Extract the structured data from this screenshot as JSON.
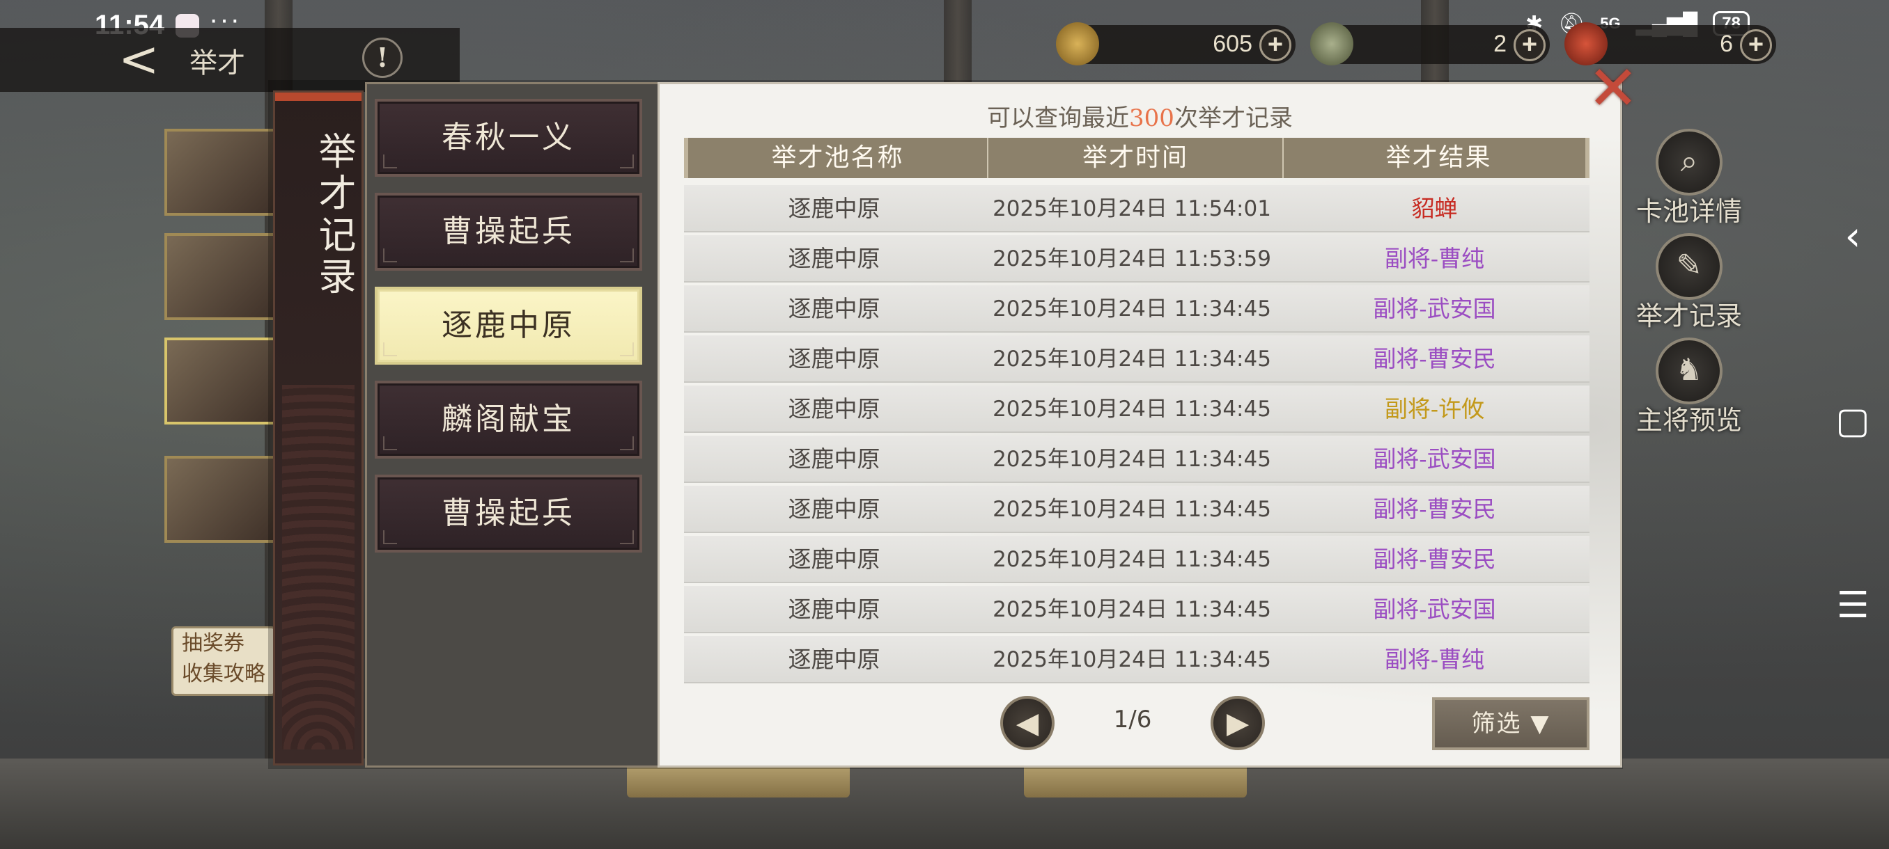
{
  "status_bar": {
    "time": "11:54",
    "more": "···",
    "battery": "78",
    "network": "5G"
  },
  "header": {
    "back_icon": "back-arrow-icon",
    "title": "举才",
    "help_label": "!"
  },
  "resources": [
    {
      "value": "605",
      "icon": "coin-icon"
    },
    {
      "value": "2",
      "icon": "jade-icon"
    },
    {
      "value": "6",
      "icon": "token-icon"
    }
  ],
  "side_menu": [
    {
      "label": "卡池详情",
      "icon": "magnifier-icon"
    },
    {
      "label": "举才记录",
      "icon": "scroll-icon"
    },
    {
      "label": "主将预览",
      "icon": "general-icon"
    }
  ],
  "background": {
    "ticket_line1": "抽奖券",
    "ticket_line2": "收集攻略"
  },
  "dialog": {
    "side_title": "举才记录",
    "notice_prefix": "可以查询最近",
    "notice_count": "300",
    "notice_suffix": "次举才记录",
    "pools": [
      {
        "label": "春秋一义",
        "active": false
      },
      {
        "label": "曹操起兵",
        "active": false
      },
      {
        "label": "逐鹿中原",
        "active": true
      },
      {
        "label": "麟阁献宝",
        "active": false
      },
      {
        "label": "曹操起兵",
        "active": false
      }
    ],
    "columns": [
      "举才池名称",
      "举才时间",
      "举才结果"
    ],
    "rows": [
      {
        "pool": "逐鹿中原",
        "time": "2025年10月24日 11:54:01",
        "result": "貂蝉",
        "color": "#c72b22"
      },
      {
        "pool": "逐鹿中原",
        "time": "2025年10月24日 11:53:59",
        "result": "副将-曹纯",
        "color": "#9b4dc2"
      },
      {
        "pool": "逐鹿中原",
        "time": "2025年10月24日 11:34:45",
        "result": "副将-武安国",
        "color": "#9b4dc2"
      },
      {
        "pool": "逐鹿中原",
        "time": "2025年10月24日 11:34:45",
        "result": "副将-曹安民",
        "color": "#9b4dc2"
      },
      {
        "pool": "逐鹿中原",
        "time": "2025年10月24日 11:34:45",
        "result": "副将-许攸",
        "color": "#c3991a"
      },
      {
        "pool": "逐鹿中原",
        "time": "2025年10月24日 11:34:45",
        "result": "副将-武安国",
        "color": "#9b4dc2"
      },
      {
        "pool": "逐鹿中原",
        "time": "2025年10月24日 11:34:45",
        "result": "副将-曹安民",
        "color": "#9b4dc2"
      },
      {
        "pool": "逐鹿中原",
        "time": "2025年10月24日 11:34:45",
        "result": "副将-曹安民",
        "color": "#9b4dc2"
      },
      {
        "pool": "逐鹿中原",
        "time": "2025年10月24日 11:34:45",
        "result": "副将-武安国",
        "color": "#9b4dc2"
      },
      {
        "pool": "逐鹿中原",
        "time": "2025年10月24日 11:34:45",
        "result": "副将-曹纯",
        "color": "#9b4dc2"
      }
    ],
    "page": "1/6",
    "filter_label": "筛选",
    "close_icon": "close-x-icon"
  }
}
